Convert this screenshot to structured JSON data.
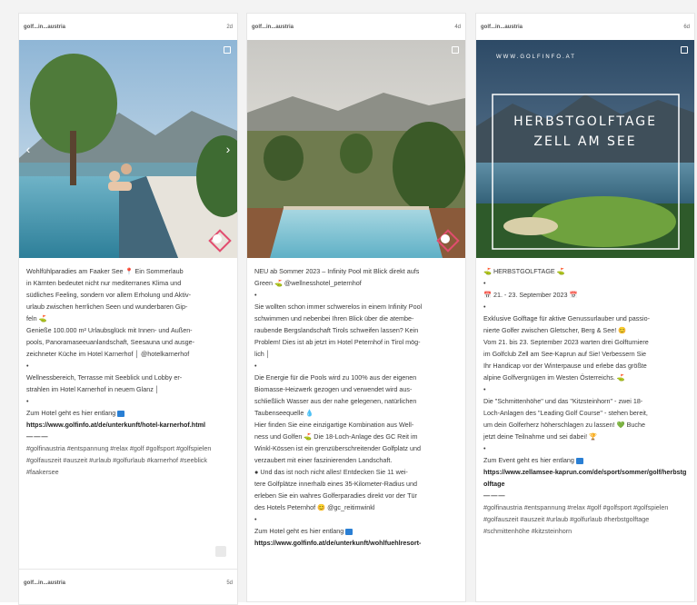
{
  "posts": [
    {
      "user": "golf...in...austria",
      "age": "2d",
      "lines": [
        "Wohlfühlparadies am Faaker See 📍 Ein Sommerlaub",
        "in Kärnten bedeutet nicht nur mediterranes Klima und",
        "südliches Feeling, sondern vor allem Erholung und Aktiv-",
        "urlaub zwischen herrlichen Seen und wunderbaren Gip-",
        "feln ⛳",
        "Genieße 100.000 m² Urlaubsglück mit Innen- und Außen-",
        "pools, Panoramaseeuanlandschaft, Seesauna und ausge-",
        "zeichneter Küche im Hotel Karnerhof │ @hotelkarnerhof",
        "•",
        "Wellnessbereich, Terrasse mit Seeblick und Lobby er-",
        "strahlen im Hotel Karnerhof in neuem Glanz │",
        "•",
        "Zum Hotel geht es hier entlang"
      ],
      "link": "https://www.golfinfo.at/de/unterkunft/hotel-karnerhof.html",
      "sep": "———",
      "tags": "#golfinaustria #entspannung #relax #golf #golfsport #golfspielen #golfauszeit #auszeit #urlaub #golfurlaub #karnerhof #seeblick #faakersee"
    },
    {
      "user": "golf...in...austria",
      "age": "4d",
      "lines": [
        "NEU ab Sommer 2023 – Infinity Pool mit Blick direkt aufs",
        "Green ⛳ @wellnesshotel_peternhof",
        "•",
        "Sie wollten schon immer schwerelos in einem Infinity Pool",
        "schwimmen und nebenbei Ihren Blick über die atembe-",
        "raubende Bergslandschaft Tirols schweifen lassen? Kein",
        "Problem! Dies ist ab jetzt im Hotel Peternhof in Tirol mög-",
        "lich │",
        "•",
        "Die Energie für die Pools wird zu 100% aus der eigenen",
        "Biomasse-Heizwerk gezogen und verwendet wird aus-",
        "schließlich Wasser aus der nahe gelegenen, natürlichen",
        "Taubenseequelle 💧",
        "Hier finden Sie eine einzigartige Kombination aus Well-",
        "ness und Golfen ⛳ Die 18-Loch-Anlage des GC Reit im",
        "Winkl-Kössen ist ein grenzüberschreitender Golfplatz und",
        "verzaubert mit einer faszinierenden Landschaft.",
        "● Und das ist noch nicht alles! Entdecken Sie 11 wei-",
        "tere Golfplätze innerhalb eines 35-Kilometer-Radius und",
        "erleben Sie ein wahres Golferparadies direkt vor der Tür",
        "des Hotels Peternhof 😊 @gc_reitimwinkl",
        "•",
        "Zum Hotel geht es hier entlang"
      ],
      "link": "https://www.golfinfo.at/de/unterkunft/wohlfuehlresort-"
    },
    {
      "user": "golf...in...austria",
      "age": "6d",
      "overlay_site": "WWW.GOLFINFO.AT",
      "overlay_title_1": "HERBSTGOLFTAGE",
      "overlay_title_2": "ZELL AM SEE",
      "lines": [
        "⛳ HERBSTGOLFTAGE ⛳",
        "•",
        "📅 21. - 23. September 2023 📅",
        "•",
        "Exklusive Golftage für aktive Genussurlauber und passio-",
        "nierte Golfer zwischen Gletscher, Berg & See! 😊",
        "Vom 21. bis 23. September 2023 warten drei Golfturniere",
        "im Golfclub Zell am See-Kaprun auf Sie! Verbessern Sie",
        "Ihr Handicap vor der Winterpause und erlebe das größte",
        "alpine Golfvergnügen im Westen Österreichs. ⛳",
        "•",
        "Die \"Schmittenhöhe\" und das \"Kitzsteinhorn\" - zwei 18-",
        "Loch-Anlagen des \"Leading Golf Course\" - stehen bereit,",
        "um dein Golferherz höherschlagen zu lassen! 💚 Buche",
        "jetzt deine Teilnahme und sei dabei! 🏆",
        "•",
        "Zum Event geht es hier entlang"
      ],
      "link": "https://www.zellamsee-kaprun.com/de/sport/sommer/golf/herbstgolftage",
      "sep": "———",
      "tags": "#golfinaustria #entspannung #relax #golf #golfsport #golfspielen #golfauszeit #auszeit #urlaub #golfurlaub #herbstgolftage #schmittenhöhe #kitzsteinhorn"
    }
  ],
  "next_post": {
    "user": "golf...in...austria",
    "age": "5d"
  },
  "colors": {
    "link_square": "#2a7fd4",
    "divider": "#e6e6e6"
  },
  "icons": [
    "multi-image-icon",
    "chevron-left-icon",
    "chevron-right-icon",
    "golf-badge-icon",
    "link-arrow-icon",
    "save-icon"
  ]
}
